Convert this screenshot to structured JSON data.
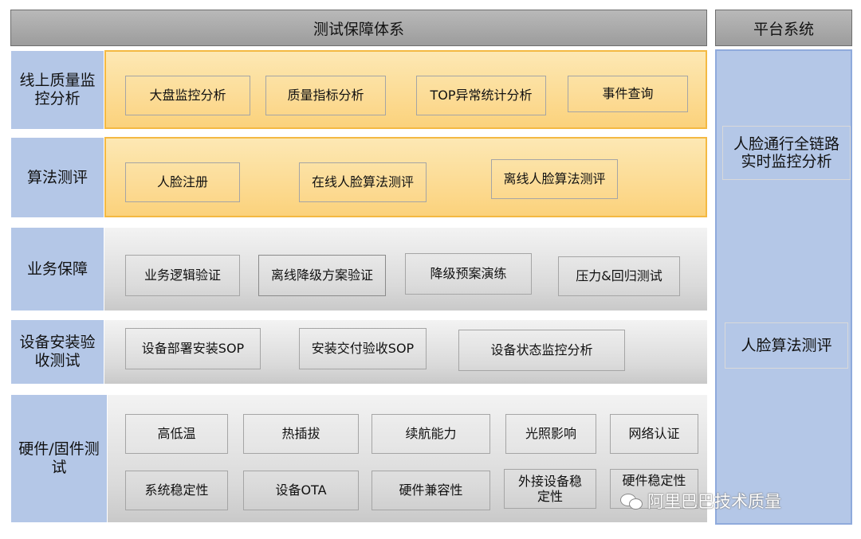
{
  "header": {
    "main_title": "测试保障体系",
    "platform_title": "平台系统"
  },
  "rows": [
    {
      "label": "线上质量监控分析",
      "items": [
        "大盘监控分析",
        "质量指标分析",
        "TOP异常统计分析",
        "事件查询"
      ]
    },
    {
      "label": "算法测评",
      "items": [
        "人脸注册",
        "在线人脸算法测评",
        "离线人脸算法测评"
      ]
    },
    {
      "label": "业务保障",
      "items": [
        "业务逻辑验证",
        "离线降级方案验证",
        "降级预案演练",
        "压力&回归测试"
      ]
    },
    {
      "label": "设备安装验收测试",
      "items": [
        "设备部署安装SOP",
        "安装交付验收SOP",
        "设备状态监控分析"
      ]
    },
    {
      "label": "硬件/固件测试",
      "items": [
        "高低温",
        "热插拔",
        "续航能力",
        "光照影响",
        "网络认证",
        "系统稳定性",
        "设备OTA",
        "硬件兼容性",
        "外接设备稳定性",
        "硬件稳定性"
      ]
    }
  ],
  "platform": {
    "items": [
      "人脸通行全链路实时监控分析",
      "人脸算法测评"
    ]
  },
  "watermark": {
    "text": "阿里巴巴技术质量",
    "icon": "wechat-icon"
  },
  "colors": {
    "header_gray": "#a6a6a6",
    "label_blue": "#b4c7e7",
    "orange_panel": "#fcd68a",
    "orange_border": "#f4b942",
    "gray_panel": "#d9d9d9"
  }
}
